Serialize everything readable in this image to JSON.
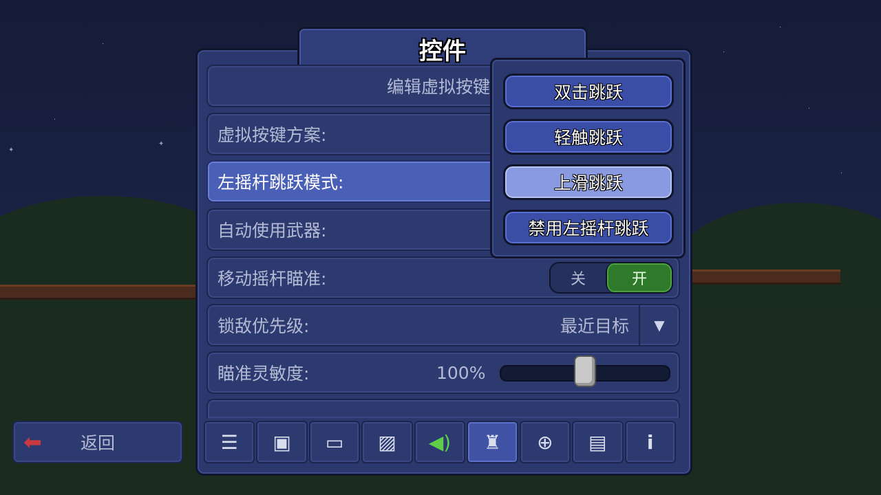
{
  "title": "控件",
  "rows": {
    "edit_virtual_keys": "编辑虚拟按键",
    "virtual_key_scheme": "虚拟按键方案:",
    "left_stick_jump_mode": "左摇杆跳跃模式:",
    "auto_use_weapon": "自动使用武器:",
    "move_stick_aim": {
      "label": "移动摇杆瞄准:",
      "off": "关",
      "on": "开",
      "state": "on"
    },
    "lock_priority": {
      "label": "锁敌优先级:",
      "value": "最近目标"
    },
    "aim_sensitivity": {
      "label": "瞄准灵敏度:",
      "value": "100%",
      "level": 0.5
    }
  },
  "dropdown": {
    "options": [
      "双击跳跃",
      "轻触跳跃",
      "上滑跳跃",
      "禁用左摇杆跳跃"
    ],
    "selected": "上滑跳跃"
  },
  "bottom_tabs": [
    {
      "icon": "menu-icon",
      "active": false
    },
    {
      "icon": "interface-icon",
      "active": false
    },
    {
      "icon": "video-icon",
      "active": false
    },
    {
      "icon": "image-icon",
      "active": false
    },
    {
      "icon": "speaker-icon",
      "active": false
    },
    {
      "icon": "joystick-icon",
      "active": true
    },
    {
      "icon": "gamepad-icon",
      "active": false
    },
    {
      "icon": "chat-icon",
      "active": false
    },
    {
      "icon": "info-icon",
      "active": false
    }
  ],
  "back_label": "返回",
  "colors": {
    "toggle_on": "#2e7a2a",
    "highlight_row": "#4a5fb6",
    "selected_option": "#8a9ae0",
    "back_arrow": "#c83a40"
  }
}
